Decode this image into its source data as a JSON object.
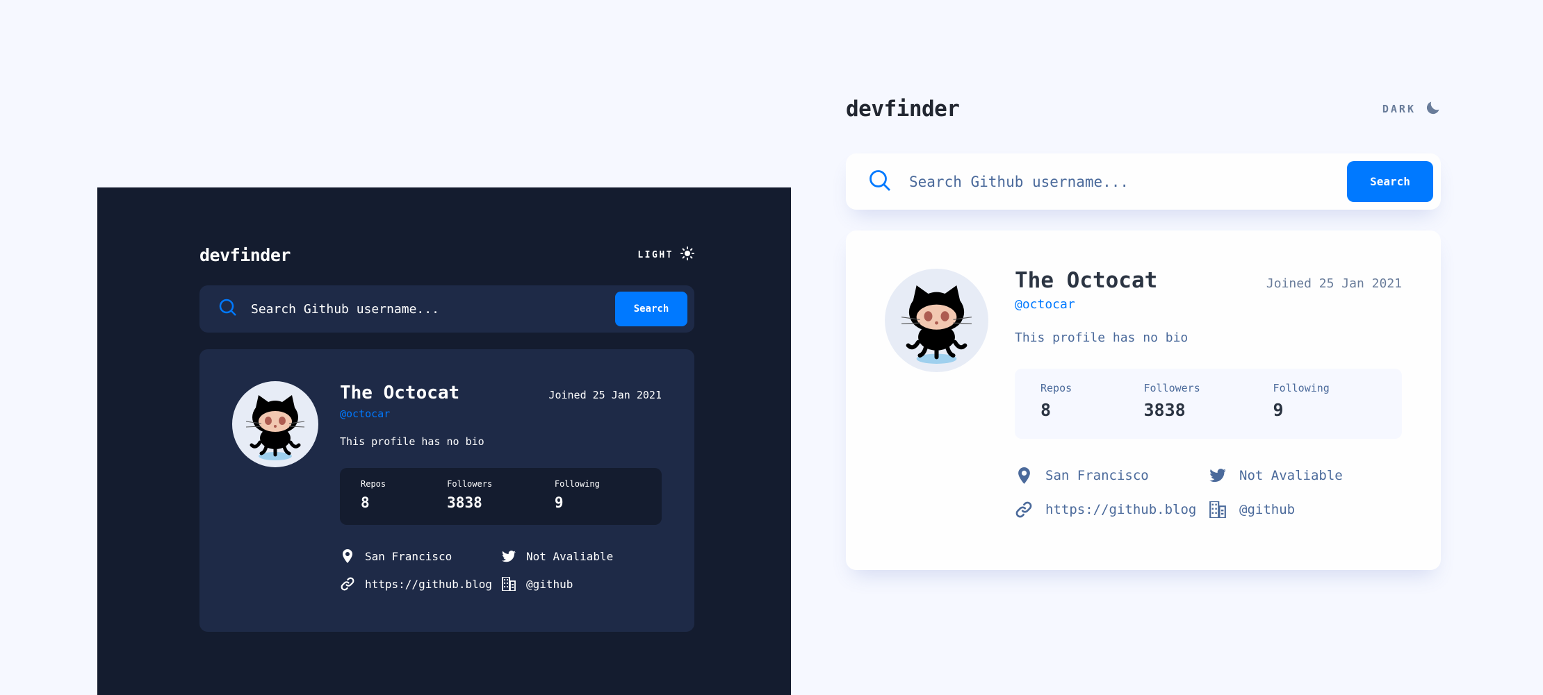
{
  "dark": {
    "logo": "devfinder",
    "theme_toggle_label": "LIGHT",
    "search_placeholder": "Search Github username...",
    "search_button": "Search",
    "profile": {
      "name": "The Octocat",
      "joined": "Joined 25 Jan 2021",
      "login": "@octocar",
      "bio": "This profile has no bio",
      "stats": [
        {
          "label": "Repos",
          "value": "8"
        },
        {
          "label": "Followers",
          "value": "3838"
        },
        {
          "label": "Following",
          "value": "9"
        }
      ],
      "location": "San Francisco",
      "twitter": "Not Avaliable",
      "blog": "https://github.blog",
      "company": "@github"
    }
  },
  "light": {
    "logo": "devfinder",
    "theme_toggle_label": "DARK",
    "search_placeholder": "Search Github username...",
    "search_button": "Search",
    "profile": {
      "name": "The Octocat",
      "joined": "Joined 25 Jan 2021",
      "login": "@octocar",
      "bio": "This profile has no bio",
      "stats": [
        {
          "label": "Repos",
          "value": "8"
        },
        {
          "label": "Followers",
          "value": "3838"
        },
        {
          "label": "Following",
          "value": "9"
        }
      ],
      "location": "San Francisco",
      "twitter": "Not Avaliable",
      "blog": "https://github.blog",
      "company": "@github"
    }
  },
  "icons": {
    "search": "search-icon",
    "sun": "sun-icon",
    "moon": "moon-icon",
    "location": "location-pin-icon",
    "twitter": "twitter-icon",
    "link": "link-icon",
    "company": "building-icon"
  },
  "colors": {
    "accent": "#0079ff",
    "dark_bg": "#141c2f",
    "dark_card": "#1e2a47",
    "light_bg": "#f6f8ff",
    "light_card": "#fefefe",
    "light_text": "#4b6a9b"
  }
}
